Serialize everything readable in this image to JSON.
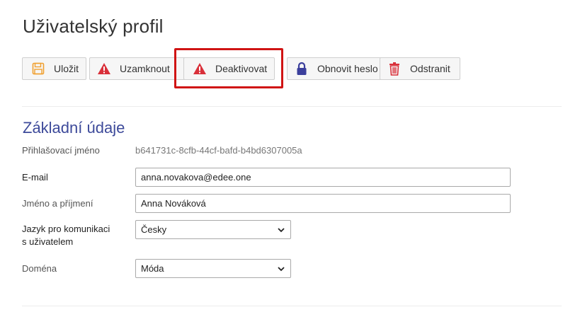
{
  "page": {
    "title": "Uživatelský profil"
  },
  "toolbar": {
    "save_label": "Uložit",
    "lock_label": "Uzamknout",
    "deactivate_label": "Deaktivovat",
    "reset_password_label": "Obnovit heslo",
    "delete_label": "Odstranit",
    "icons": {
      "save": "floppy-disk-icon",
      "lock": "warning-triangle-icon",
      "deactivate": "warning-triangle-icon",
      "reset_password": "padlock-icon",
      "delete": "trash-icon"
    }
  },
  "colors": {
    "section_title": "#3d4a9a",
    "warning": "#d9303a",
    "highlight": "#d01414",
    "save_icon": "#f0a030",
    "padlock_icon": "#3b3f9c"
  },
  "section": {
    "title": "Základní údaje",
    "login_label": "Přihlašovací jméno",
    "login_value": "b641731c-8cfb-44cf-bafd-b4bd6307005a",
    "email_label": "E-mail",
    "email_value": "anna.novakova@edee.one",
    "name_label": "Jméno a příjmení",
    "name_value": "Anna Nováková",
    "language_label_line1": "Jazyk pro komunikaci",
    "language_label_line2": "s uživatelem",
    "language_value": "Česky",
    "domain_label": "Doména",
    "domain_value": "Móda"
  }
}
